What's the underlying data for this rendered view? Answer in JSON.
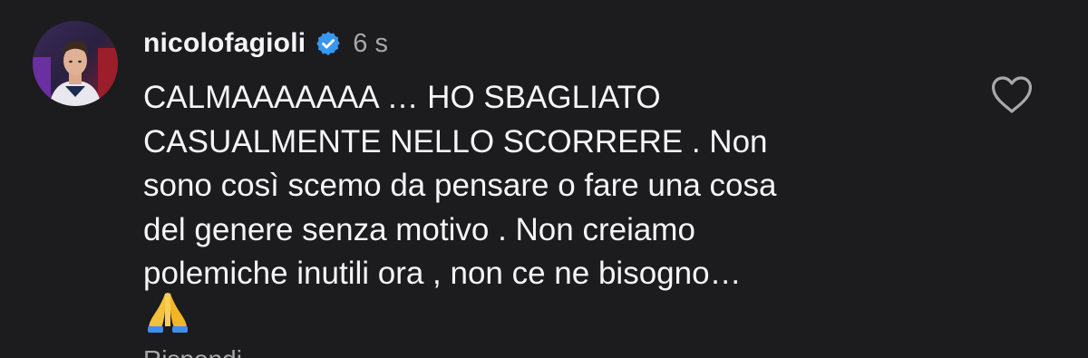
{
  "comment": {
    "username": "nicolofagioli",
    "timestamp": "6 s",
    "text_lines": [
      "CALMAAAAAAA … HO SBAGLIATO",
      "CASUALMENTE NELLO SCORRERE . Non",
      "sono così scemo da pensare o fare una cosa",
      "del genere senza motivo . Non creiamo",
      "polemiche inutili ora , non ce ne bisogno…"
    ],
    "emoji": "🙏",
    "reply_label": "Rispondi"
  },
  "icons": {
    "verified": "verified-badge-icon",
    "like": "heart-outline-icon",
    "emoji": "folded-hands-icon"
  },
  "colors": {
    "background": "#1c1c1e",
    "text": "#f5f5f5",
    "secondary": "#a8a8a8",
    "verified": "#3897f0"
  }
}
